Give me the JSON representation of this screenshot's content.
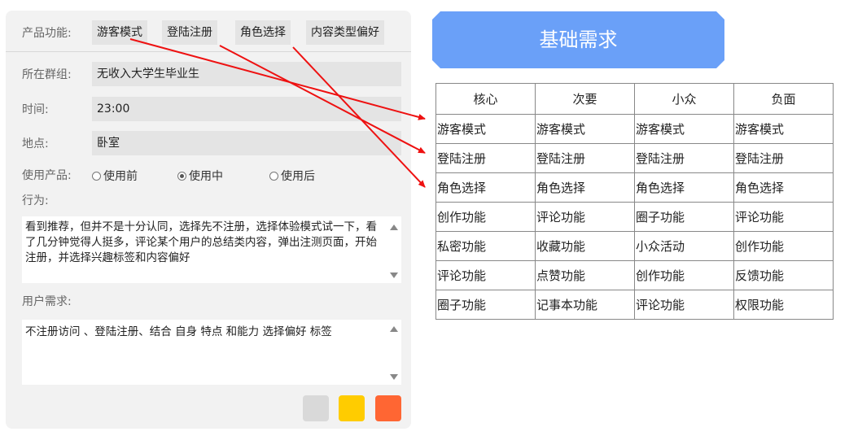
{
  "form": {
    "feature_label": "产品功能:",
    "features": [
      "游客模式",
      "登陆注册",
      "角色选择",
      "内容类型偏好"
    ],
    "group_label": "所在群组:",
    "group_value": "无收入大学生毕业生",
    "time_label": "时间:",
    "time_value": "23:00",
    "place_label": "地点:",
    "place_value": "卧室",
    "usage_label": "使用产品:",
    "usage_options": [
      "使用前",
      "使用中",
      "使用后"
    ],
    "usage_selected": "使用中",
    "behavior_label": "行为:",
    "behavior_text": "看到推荐，但并不是十分认同，选择先不注册，选择体验模式试一下，看了几分钟觉得人挺多，评论某个用户的总结类内容，弹出注测页面，开始注册，并选择兴趣标签和内容偏好",
    "needs_label": "用户需求:",
    "needs_text": "不注册访问 、登陆注册、结合 自身 特点 和能力 选择偏好 标签"
  },
  "swatches": [
    "#d9d9d9",
    "#ffcc00",
    "#ff6633"
  ],
  "banner_title": "基础需求",
  "table": {
    "headers": [
      "核心",
      "次要",
      "小众",
      "负面"
    ],
    "rows": [
      [
        "游客模式",
        "游客模式",
        "游客模式",
        "游客模式"
      ],
      [
        "登陆注册",
        "登陆注册",
        "登陆注册",
        "登陆注册"
      ],
      [
        "角色选择",
        "角色选择",
        "角色选择",
        "角色选择"
      ],
      [
        "创作功能",
        "评论功能",
        "圈子功能",
        "评论功能"
      ],
      [
        "私密功能",
        "收藏功能",
        "小众活动",
        "创作功能"
      ],
      [
        "评论功能",
        "点赞功能",
        "创作功能",
        "反馈功能"
      ],
      [
        "圈子功能",
        "记事本功能",
        "评论功能",
        "权限功能"
      ]
    ]
  },
  "colors": {
    "banner": "#6aa0f8",
    "arrow": "#ee1111",
    "panel": "#f2f2f2"
  }
}
